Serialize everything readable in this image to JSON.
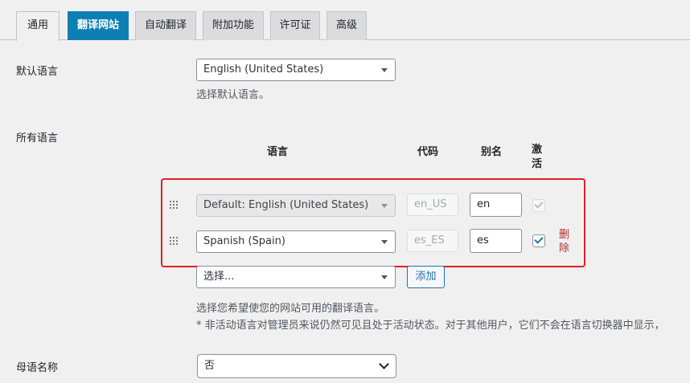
{
  "tabs": [
    {
      "label": "通用"
    },
    {
      "label": "翻译网站"
    },
    {
      "label": "自动翻译"
    },
    {
      "label": "附加功能"
    },
    {
      "label": "许可证"
    },
    {
      "label": "高级"
    }
  ],
  "default_language": {
    "label": "默认语言",
    "selected": "English (United States)",
    "description": "选择默认语言。"
  },
  "all_languages": {
    "label": "所有语言",
    "columns": {
      "language": "语言",
      "code": "代码",
      "slug": "别名",
      "active": "激活"
    },
    "rows": [
      {
        "language": "Default: English (United States)",
        "code": "en_US",
        "slug": "en",
        "active": true
      },
      {
        "language": "Spanish (Spain)",
        "code": "es_ES",
        "slug": "es",
        "active": true,
        "remove_label": "删除"
      }
    ],
    "add_select_placeholder": "选择...",
    "add_button": "添加",
    "description_1": "选择您希望使您的网站可用的翻译语言。",
    "description_2": "* 非活动语言对管理员来说仍然可见且处于活动状态。对于其他用户，它们不会在语言切换器中显示，"
  },
  "native_names": {
    "label": "母语名称",
    "selected": "否"
  },
  "colors": {
    "brand_tab": "#0f7fb3",
    "highlight": "#e02020",
    "remove": "#b32d2e"
  }
}
